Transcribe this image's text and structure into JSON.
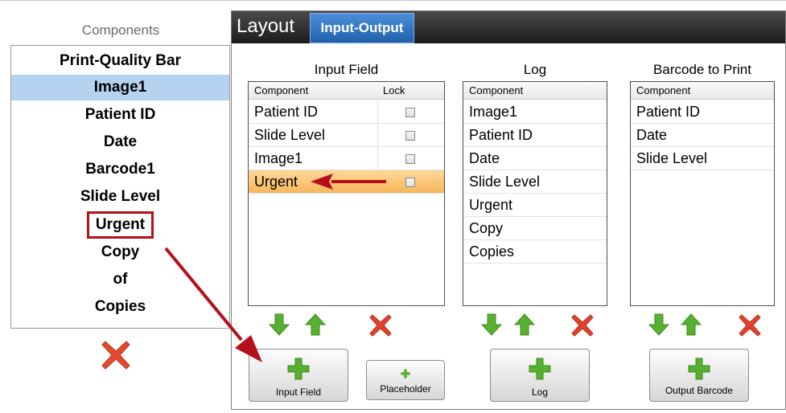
{
  "components": {
    "title": "Components",
    "items": [
      "Print-Quality Bar",
      "Image1",
      "Patient ID",
      "Date",
      "Barcode1",
      "Slide Level",
      "Urgent",
      "Copy",
      "of",
      "Copies"
    ],
    "selected": "Image1",
    "highlighted": "Urgent",
    "remove_icon": "red-x-icon"
  },
  "tabs": {
    "layout": "Layout",
    "input_output": "Input-Output",
    "active": "Input-Output"
  },
  "input_field": {
    "title": "Input Field",
    "col_component": "Component",
    "col_lock": "Lock",
    "rows": [
      "Patient ID",
      "Slide Level",
      "Image1",
      "Urgent"
    ],
    "locked": [
      false,
      false,
      false,
      false
    ],
    "selected": "Urgent",
    "add_button": "Input Field",
    "placeholder_button": "Placeholder"
  },
  "log": {
    "title": "Log",
    "col_component": "Component",
    "rows": [
      "Image1",
      "Patient ID",
      "Date",
      "Slide Level",
      "Urgent",
      "Copy",
      "Copies"
    ],
    "add_button": "Log"
  },
  "barcode": {
    "title": "Barcode to Print",
    "col_component": "Component",
    "rows": [
      "Patient ID",
      "Date",
      "Slide Level"
    ],
    "add_button": "Output Barcode"
  },
  "icons": {
    "move_down": "green-arrow-down-icon",
    "move_up": "green-arrow-up-icon",
    "remove": "red-x-icon",
    "add": "green-plus-icon",
    "annotation": "red-arrow-icon"
  },
  "colors": {
    "selection": "#b5d3f0",
    "highlight_row": "#f7b75a",
    "annotation_red": "#b50f1b",
    "tab_active": "#2f72c2",
    "tab_bar": "#2a2a2a",
    "icon_green": "#57b030",
    "icon_red": "#e0412c"
  }
}
